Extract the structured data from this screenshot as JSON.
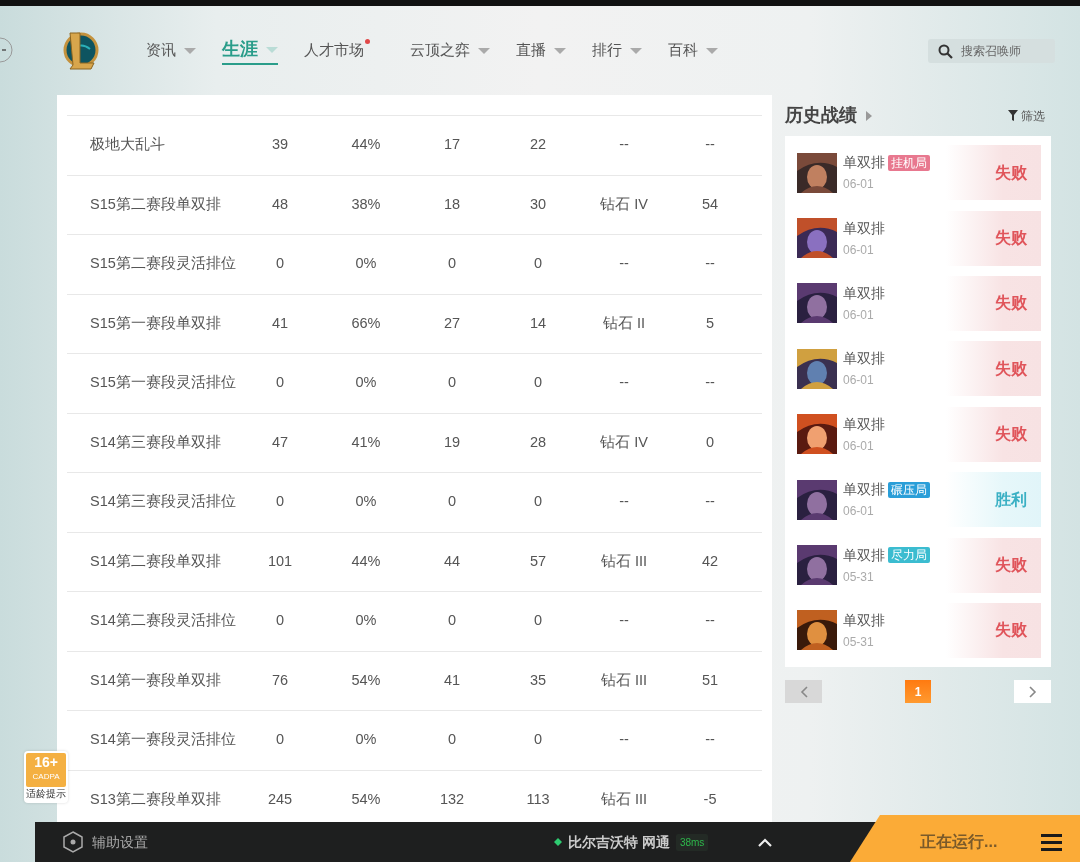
{
  "nav": {
    "items": [
      {
        "label": "资讯",
        "selected": false,
        "caret": true,
        "dot": false
      },
      {
        "label": "生涯",
        "selected": true,
        "caret": true,
        "dot": false
      },
      {
        "label": "人才市场",
        "selected": false,
        "caret": false,
        "dot": true
      },
      {
        "label": "云顶之弈",
        "selected": false,
        "caret": true,
        "dot": false
      },
      {
        "label": "直播",
        "selected": false,
        "caret": true,
        "dot": false
      },
      {
        "label": "排行",
        "selected": false,
        "caret": true,
        "dot": false
      },
      {
        "label": "百科",
        "selected": false,
        "caret": true,
        "dot": false
      }
    ],
    "search": {
      "placeholder": "搜索召唤师"
    }
  },
  "table": {
    "rows": [
      [
        "极地大乱斗",
        "39",
        "44%",
        "17",
        "22",
        "--",
        "--"
      ],
      [
        "S15第二赛段单双排",
        "48",
        "38%",
        "18",
        "30",
        "钻石 IV",
        "54"
      ],
      [
        "S15第二赛段灵活排位",
        "0",
        "0%",
        "0",
        "0",
        "--",
        "--"
      ],
      [
        "S15第一赛段单双排",
        "41",
        "66%",
        "27",
        "14",
        "钻石 II",
        "5"
      ],
      [
        "S15第一赛段灵活排位",
        "0",
        "0%",
        "0",
        "0",
        "--",
        "--"
      ],
      [
        "S14第三赛段单双排",
        "47",
        "41%",
        "19",
        "28",
        "钻石 IV",
        "0"
      ],
      [
        "S14第三赛段灵活排位",
        "0",
        "0%",
        "0",
        "0",
        "--",
        "--"
      ],
      [
        "S14第二赛段单双排",
        "101",
        "44%",
        "44",
        "57",
        "钻石 III",
        "42"
      ],
      [
        "S14第二赛段灵活排位",
        "0",
        "0%",
        "0",
        "0",
        "--",
        "--"
      ],
      [
        "S14第一赛段单双排",
        "76",
        "54%",
        "41",
        "35",
        "钻石 III",
        "51"
      ],
      [
        "S14第一赛段灵活排位",
        "0",
        "0%",
        "0",
        "0",
        "--",
        "--"
      ],
      [
        "S13第二赛段单双排",
        "245",
        "54%",
        "132",
        "113",
        "钻石 III",
        "-5"
      ]
    ]
  },
  "history": {
    "title": "历史战绩",
    "filter": "筛选",
    "matches": [
      {
        "mode": "单双排",
        "tag": {
          "label": "挂机局",
          "color": "#e8788f"
        },
        "date": "06-01",
        "result": "失败",
        "kind": "loss"
      },
      {
        "mode": "单双排",
        "date": "06-01",
        "result": "失败",
        "kind": "loss"
      },
      {
        "mode": "单双排",
        "date": "06-01",
        "result": "失败",
        "kind": "loss"
      },
      {
        "mode": "单双排",
        "date": "06-01",
        "result": "失败",
        "kind": "loss"
      },
      {
        "mode": "单双排",
        "date": "06-01",
        "result": "失败",
        "kind": "loss"
      },
      {
        "mode": "单双排",
        "tag": {
          "label": "碾压局",
          "color": "#2a9ed8"
        },
        "date": "06-01",
        "result": "胜利",
        "kind": "win"
      },
      {
        "mode": "单双排",
        "tag": {
          "label": "尽力局",
          "color": "#3bbcd0"
        },
        "date": "05-31",
        "result": "失败",
        "kind": "loss"
      },
      {
        "mode": "单双排",
        "date": "05-31",
        "result": "失败",
        "kind": "loss"
      }
    ],
    "pages": [
      {
        "label": "1",
        "selected": true
      }
    ]
  },
  "age_badge": {
    "rating": "16+",
    "org": "CADPA",
    "caption": "适龄提示"
  },
  "footer": {
    "settings": "辅助设置",
    "server": "比尔吉沃特 网通",
    "ping": "38ms",
    "status": "正在运行..."
  }
}
